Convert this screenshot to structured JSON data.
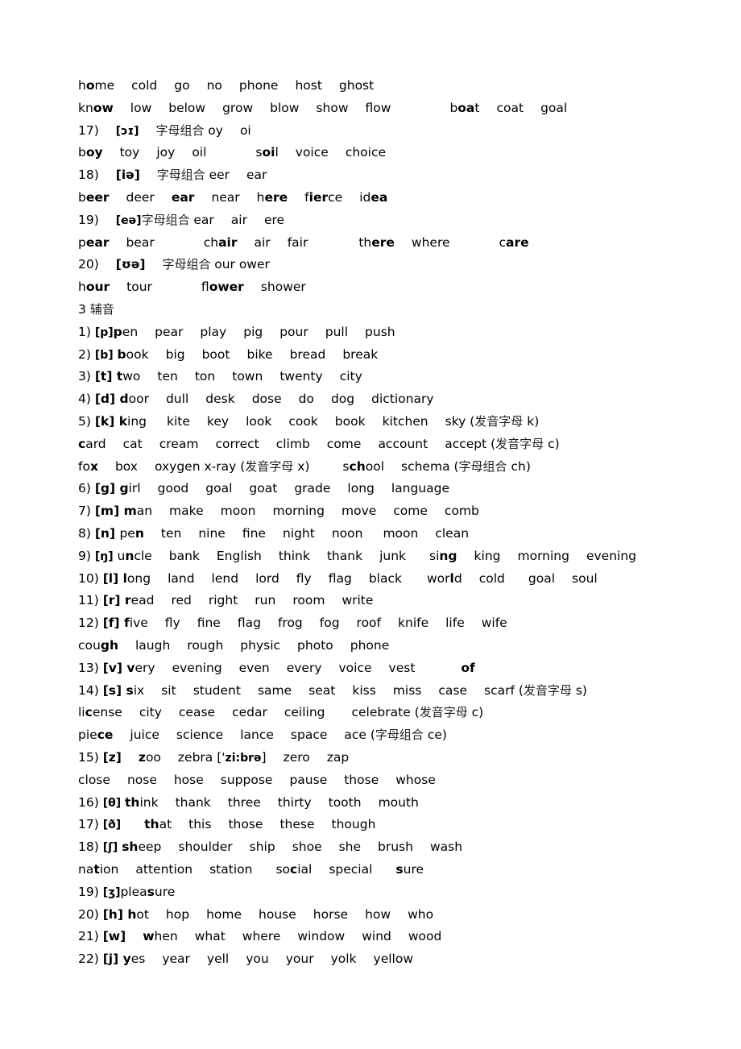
{
  "document": {
    "lines": [
      [
        [
          [
            "h",
            0
          ],
          [
            "o",
            1
          ],
          [
            "me",
            0
          ]
        ],
        "cold",
        "go",
        "no",
        "phone",
        "host",
        "ghost"
      ],
      [
        [
          [
            "kn",
            0
          ],
          [
            "ow",
            1
          ]
        ],
        "low",
        "below",
        "grow",
        "blow",
        "show",
        "flow",
        [
          [
            "b",
            0
          ],
          [
            "oa",
            1
          ],
          [
            "t",
            0
          ]
        ],
        "coat",
        "goal"
      ],
      [
        "17)",
        [
          [
            "[ɔɪ]",
            2
          ]
        ],
        [
          [
            "字母组合 ",
            3
          ],
          [
            "oy",
            0
          ]
        ],
        "oi"
      ],
      [
        [
          [
            "b",
            0
          ],
          [
            "oy",
            1
          ]
        ],
        "toy",
        "joy",
        "oil",
        [
          [
            "s",
            0
          ],
          [
            "oi",
            1
          ],
          [
            "l",
            0
          ]
        ],
        "voice",
        "choice"
      ],
      [
        "18)",
        [
          [
            "[iə]",
            1
          ]
        ],
        [
          [
            "字母组合 ",
            3
          ],
          [
            "eer",
            0
          ]
        ],
        "ear"
      ],
      [
        [
          [
            "b",
            0
          ],
          [
            "eer",
            1
          ]
        ],
        "deer",
        [
          [
            "ear",
            1
          ]
        ],
        "near",
        [
          [
            "h",
            0
          ],
          [
            "ere",
            1
          ]
        ],
        [
          [
            "f",
            0
          ],
          [
            "ier",
            1
          ],
          [
            "ce",
            0
          ]
        ],
        [
          [
            "id",
            0
          ],
          [
            "ea",
            1
          ]
        ]
      ],
      [
        "19)",
        [
          [
            "[eə]",
            2
          ],
          [
            "字母组合 ",
            3
          ],
          [
            "ear",
            0
          ]
        ],
        "air",
        "ere"
      ],
      [
        [
          [
            "p",
            0
          ],
          [
            "ear",
            1
          ]
        ],
        "bear",
        [
          [
            "ch",
            0
          ],
          [
            "air",
            1
          ]
        ],
        "air",
        "fair",
        [
          [
            "th",
            0
          ],
          [
            "ere",
            1
          ]
        ],
        "where",
        [
          [
            "c",
            0
          ],
          [
            "are",
            1
          ]
        ]
      ],
      [
        "20)",
        [
          [
            "[ʊə]",
            1
          ]
        ],
        [
          [
            "字母组合 ",
            3
          ],
          [
            "our ower",
            0
          ]
        ]
      ],
      [
        [
          [
            "h",
            0
          ],
          [
            "our",
            1
          ]
        ],
        "tour",
        [
          [
            "fl",
            0
          ],
          [
            "ower",
            1
          ]
        ],
        "shower"
      ],
      [
        [
          [
            "3  ",
            0
          ],
          [
            "辅音",
            3
          ]
        ]
      ],
      [
        [
          [
            "1) ",
            0
          ],
          [
            "[p]",
            2
          ],
          [
            "p",
            1
          ],
          [
            "en",
            0
          ]
        ],
        "pear",
        "play",
        "pig",
        "pour",
        "pull",
        "push"
      ],
      [
        [
          [
            "2) ",
            0
          ],
          [
            "[b] ",
            2
          ],
          [
            "b",
            1
          ],
          [
            "ook",
            0
          ]
        ],
        "big",
        "boot",
        "bike",
        "bread",
        "break"
      ],
      [
        [
          [
            "3) ",
            0
          ],
          [
            "[t] ",
            1
          ],
          [
            "t",
            1
          ],
          [
            "wo",
            0
          ]
        ],
        "ten",
        "ton",
        "town",
        "twenty",
        "city"
      ],
      [
        [
          [
            "4) ",
            0
          ],
          [
            "[d] ",
            1
          ],
          [
            "d",
            1
          ],
          [
            "oor",
            0
          ]
        ],
        "dull",
        "desk",
        "dose",
        "do",
        "dog",
        "dictionary"
      ],
      [
        [
          [
            "5) ",
            0
          ],
          [
            "[k] ",
            1
          ],
          [
            "k",
            1
          ],
          [
            "ing",
            0
          ]
        ],
        "kite",
        "key",
        "look",
        "cook",
        "book",
        "kitchen",
        [
          [
            "sky (",
            0
          ],
          [
            "发音字母",
            3
          ],
          [
            " k)",
            0
          ]
        ]
      ],
      [
        [
          [
            "c",
            1
          ],
          [
            "ard",
            0
          ]
        ],
        "cat",
        "cream",
        "correct",
        "climb",
        "come",
        "account",
        [
          [
            "accept (",
            0
          ],
          [
            "发音字母",
            3
          ],
          [
            " c)",
            0
          ]
        ]
      ],
      [
        [
          [
            "fo",
            0
          ],
          [
            "x",
            1
          ]
        ],
        "box",
        [
          [
            "oxygen x-ray (",
            0
          ],
          [
            "发音字母",
            3
          ],
          [
            " x)",
            0
          ]
        ],
        [
          [
            "s",
            0
          ],
          [
            "ch",
            1
          ],
          [
            "ool",
            0
          ]
        ],
        [
          [
            "schema (",
            0
          ],
          [
            "字母组合",
            3
          ],
          [
            " ch)",
            0
          ]
        ]
      ],
      [
        [
          [
            "6) ",
            0
          ],
          [
            "[g] ",
            1
          ],
          [
            "g",
            1
          ],
          [
            "irl",
            0
          ]
        ],
        "good",
        "goal",
        "goat",
        "grade",
        "long",
        "language"
      ],
      [
        [
          [
            "7) ",
            0
          ],
          [
            "[m] ",
            1
          ],
          [
            "m",
            1
          ],
          [
            "an",
            0
          ]
        ],
        "make",
        "moon",
        "morning",
        "move",
        "come",
        "comb"
      ],
      [
        [
          [
            "8) ",
            0
          ],
          [
            "[n] ",
            1
          ],
          [
            "pe",
            0
          ],
          [
            "n",
            1
          ]
        ],
        "ten",
        "nine",
        "fine",
        "night",
        "noon",
        "moon",
        "clean"
      ],
      [
        [
          [
            "9) ",
            0
          ],
          [
            "[ŋ] ",
            2
          ],
          [
            "u",
            0
          ],
          [
            "n",
            1
          ],
          [
            "cle",
            0
          ]
        ],
        "bank",
        "English",
        "think",
        "thank",
        "junk",
        [
          [
            "si",
            0
          ],
          [
            "ng",
            1
          ]
        ],
        "king",
        "morning",
        "evening"
      ],
      [
        [
          [
            "10) ",
            0
          ],
          [
            "[l] ",
            1
          ],
          [
            "l",
            1
          ],
          [
            "ong",
            0
          ]
        ],
        "land",
        "lend",
        "lord",
        "fly",
        "flag",
        "black",
        [
          [
            "wor",
            0
          ],
          [
            "l",
            1
          ],
          [
            "d",
            0
          ]
        ],
        "cold",
        "goal",
        "soul"
      ],
      [
        [
          [
            "11) ",
            0
          ],
          [
            "[r] ",
            1
          ],
          [
            "r",
            1
          ],
          [
            "ead",
            0
          ]
        ],
        "red",
        "right",
        "run",
        "room",
        "write"
      ],
      [
        [
          [
            "12) ",
            0
          ],
          [
            "[f] ",
            1
          ],
          [
            "f",
            1
          ],
          [
            "ive",
            0
          ]
        ],
        "fly",
        "fine",
        "flag",
        "frog",
        "fog",
        "roof",
        "knife",
        "life",
        "wife"
      ],
      [
        [
          [
            "cou",
            0
          ],
          [
            "gh",
            1
          ]
        ],
        "laugh",
        "rough",
        "physic",
        "photo",
        "phone"
      ],
      [
        [
          [
            "13) ",
            0
          ],
          [
            "[v] ",
            1
          ],
          [
            "v",
            1
          ],
          [
            "ery",
            0
          ]
        ],
        "evening",
        "even",
        "every",
        "voice",
        "vest",
        [
          [
            "of",
            1
          ]
        ]
      ],
      [
        [
          [
            "14) ",
            0
          ],
          [
            "[s] ",
            1
          ],
          [
            "s",
            1
          ],
          [
            "ix",
            0
          ]
        ],
        "sit",
        "student",
        "same",
        "seat",
        "kiss",
        "miss",
        "case",
        [
          [
            "scarf (",
            0
          ],
          [
            "发音字母",
            3
          ],
          [
            " s)",
            0
          ]
        ]
      ],
      [
        [
          [
            "li",
            0
          ],
          [
            "c",
            1
          ],
          [
            "ense",
            0
          ]
        ],
        "city",
        "cease",
        "cedar",
        "ceiling",
        [
          [
            "celebrate (",
            0
          ],
          [
            "发音字母",
            3
          ],
          [
            " c)",
            0
          ]
        ]
      ],
      [
        [
          [
            "pie",
            0
          ],
          [
            "ce",
            1
          ]
        ],
        "juice",
        "science",
        "lance",
        "space",
        [
          [
            "ace (",
            0
          ],
          [
            "字母组合",
            3
          ],
          [
            " ce)",
            0
          ]
        ]
      ],
      [
        [
          [
            "15) ",
            0
          ],
          [
            "[z]",
            1
          ]
        ],
        [
          [
            "z",
            1
          ],
          [
            "oo",
            0
          ]
        ],
        [
          [
            "zebra [",
            0
          ],
          [
            "ˈzi:brə",
            2
          ],
          [
            "]",
            0
          ]
        ],
        "zero",
        "zap"
      ],
      [
        "close",
        "nose",
        "hose",
        "suppose",
        "pause",
        "those",
        "whose"
      ],
      [
        [
          [
            "16) ",
            0
          ],
          [
            "[θ] ",
            2
          ],
          [
            "th",
            1
          ],
          [
            "ink",
            0
          ]
        ],
        "thank",
        "three",
        "thirty",
        "tooth",
        "mouth"
      ],
      [
        [
          [
            "17) ",
            0
          ],
          [
            "[ð]",
            2
          ]
        ],
        [
          [
            "th",
            1
          ],
          [
            "at",
            0
          ]
        ],
        "this",
        "those",
        "these",
        "though"
      ],
      [
        [
          [
            "18) ",
            0
          ],
          [
            "[ʃ] ",
            2
          ],
          [
            "sh",
            1
          ],
          [
            "eep",
            0
          ]
        ],
        "shoulder",
        "ship",
        "shoe",
        "she",
        "brush",
        "wash"
      ],
      [
        [
          [
            "na",
            0
          ],
          [
            "t",
            1
          ],
          [
            "ion",
            0
          ]
        ],
        "attention",
        "station",
        [
          [
            "so",
            0
          ],
          [
            "c",
            1
          ],
          [
            "ial",
            0
          ]
        ],
        "special",
        [
          [
            "s",
            1
          ],
          [
            "ure",
            0
          ]
        ]
      ],
      [
        [
          [
            "19) ",
            0
          ],
          [
            "[ʒ]",
            2
          ],
          [
            "plea",
            0
          ],
          [
            "s",
            1
          ],
          [
            "ure",
            0
          ]
        ]
      ],
      [
        [
          [
            "20) ",
            0
          ],
          [
            "[h] ",
            1
          ],
          [
            "h",
            1
          ],
          [
            "ot",
            0
          ]
        ],
        "hop",
        "home",
        "house",
        "horse",
        "how",
        "who"
      ],
      [
        [
          [
            "21) ",
            0
          ],
          [
            "[w]",
            1
          ]
        ],
        [
          [
            "w",
            1
          ],
          [
            "hen",
            0
          ]
        ],
        "what",
        "where",
        "window",
        "wind",
        "wood"
      ],
      [
        [
          [
            "22) ",
            0
          ],
          [
            "[j] ",
            1
          ],
          [
            "y",
            1
          ],
          [
            "es",
            0
          ]
        ],
        "year",
        "yell",
        "you",
        "your",
        "yolk",
        "yellow"
      ]
    ]
  }
}
